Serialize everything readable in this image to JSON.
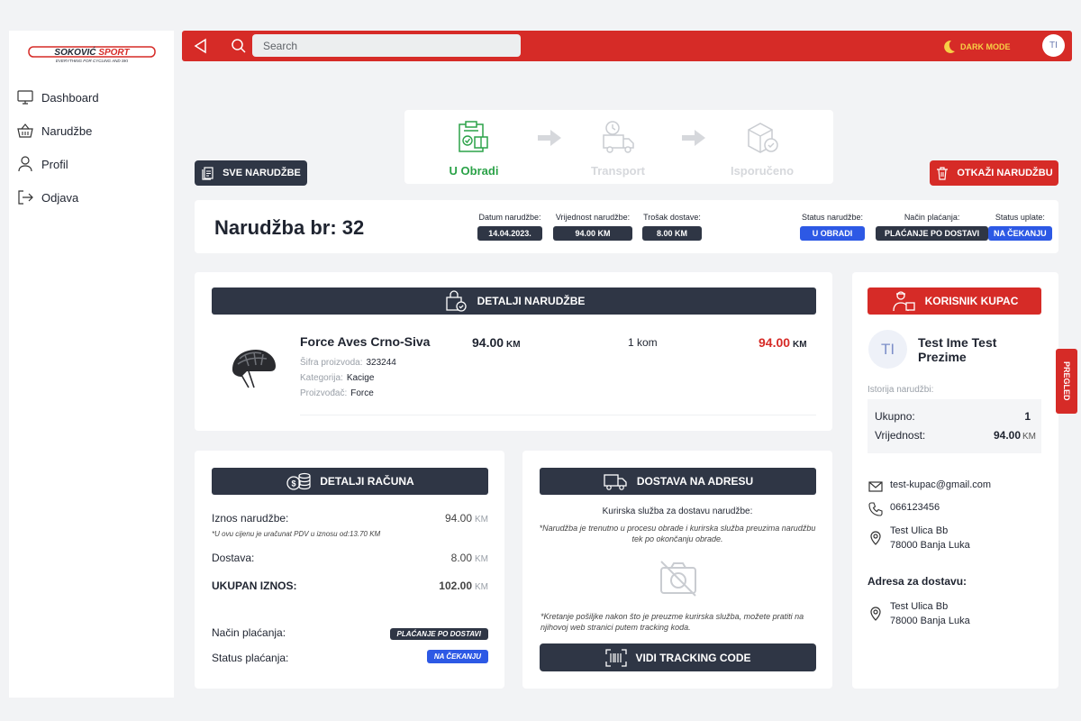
{
  "brand": {
    "logo_text": "SOKOVIĆ SPORT",
    "tagline": "EVERYTHING FOR CYCLING AND SKI",
    "red": "#d62b27",
    "dark": "#2f3645",
    "green": "#2ba248",
    "blue": "#2d59e5"
  },
  "sidebar": {
    "items": [
      {
        "label": "Dashboard",
        "icon": "monitor-icon"
      },
      {
        "label": "Narudžbe",
        "icon": "basket-icon"
      },
      {
        "label": "Profil",
        "icon": "user-icon"
      },
      {
        "label": "Odjava",
        "icon": "logout-icon"
      }
    ]
  },
  "topbar": {
    "search_placeholder": "Search",
    "dark_mode": "DARK MODE",
    "avatar": "TI"
  },
  "steps": [
    {
      "label": "U Obradi",
      "state": "active"
    },
    {
      "label": "Transport",
      "state": "inactive"
    },
    {
      "label": "Isporučeno",
      "state": "inactive"
    }
  ],
  "buttons": {
    "all_orders": "SVE NARUDŽBE",
    "cancel_order": "OTKAŽI NARUDŽBU",
    "side_tab": "PREGLED",
    "tracking": "VIDI TRACKING CODE"
  },
  "order": {
    "title": "Narudžba br: 32",
    "date_label": "Datum narudžbe:",
    "date": "14.04.2023.",
    "value_label": "Vrijednost narudžbe:",
    "value": "94.00 KM",
    "shipping_label": "Trošak dostave:",
    "shipping": "8.00 KM",
    "status_label": "Status narudžbe:",
    "status": "U OBRADI",
    "payment_label": "Način plaćanja:",
    "payment": "PLAĆANJE PO DOSTAVI",
    "pay_status_label": "Status uplate:",
    "pay_status": "NA ČEKANJU"
  },
  "details": {
    "header": "DETALJI NARUDŽBE",
    "product": {
      "name": "Force Aves Crno-Siva",
      "sku_label": "Šifra proizvoda:",
      "sku": "323244",
      "cat_label": "Kategorija:",
      "cat": "Kacige",
      "maker_label": "Proizvođač:",
      "maker": "Force",
      "price": "94.00",
      "price_unit": "KM",
      "qty": "1 kom",
      "total": "94.00",
      "total_unit": "KM"
    }
  },
  "invoice": {
    "header": "DETALJI RAČUNA",
    "amount_label": "Iznos narudžbe:",
    "amount": "94.00",
    "unit": "KM",
    "vat_note": "*U ovu cijenu je uračunat PDV u iznosu od:13.70 KM",
    "delivery_label": "Dostava:",
    "delivery": "8.00",
    "total_label": "UKUPAN IZNOS:",
    "total": "102.00",
    "method_label": "Način plaćanja:",
    "method": "PLAĆANJE PO DOSTAVI",
    "status_label": "Status plaćanja:",
    "status": "NA ČEKANJU"
  },
  "delivery": {
    "header": "DOSTAVA NA ADRESU",
    "title": "Kurirska služba za dostavu narudžbe:",
    "note1": "*Narudžba je trenutno u procesu obrade i kurirska služba preuzima narudžbu tek po okončanju obrade.",
    "note2": "*Kretanje pošiljke nakon što je preuzme kurirska služba, možete pratiti na njihovoj web stranici putem tracking koda."
  },
  "customer": {
    "header": "KORISNIK KUPAC",
    "initials": "TI",
    "name": "Test Ime Test Prezime",
    "history_label": "Istorija narudžbi:",
    "total_label": "Ukupno:",
    "total": "1",
    "value_label": "Vrijednost:",
    "value": "94.00",
    "unit": "KM",
    "email": "test-kupac@gmail.com",
    "phone": "066123456",
    "street": "Test Ulica Bb",
    "city": "78000 Banja Luka",
    "ship_label": "Adresa za dostavu:",
    "ship_street": "Test Ulica Bb",
    "ship_city": "78000 Banja Luka"
  }
}
